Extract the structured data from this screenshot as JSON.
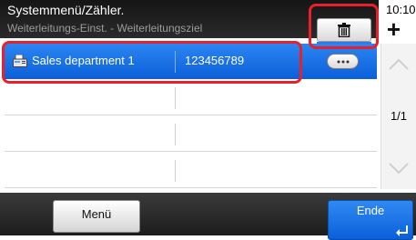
{
  "header": {
    "title": "Systemmenü/Zähler.",
    "subtitle": "Weiterleitungs-Einst. - Weiterleitungsziel",
    "time": "10:10",
    "add_icon": "+"
  },
  "list": {
    "rows": [
      {
        "name": "Sales department 1",
        "number": "123456789",
        "selected": true,
        "icon": "fax-icon"
      }
    ]
  },
  "scroll": {
    "page_indicator": "1/1"
  },
  "footer": {
    "menu_label": "Menü",
    "end_label": "Ende"
  },
  "colors": {
    "accent": "#1a72e8",
    "highlight": "#e8202a",
    "header_bg": "#1e1e1e"
  }
}
